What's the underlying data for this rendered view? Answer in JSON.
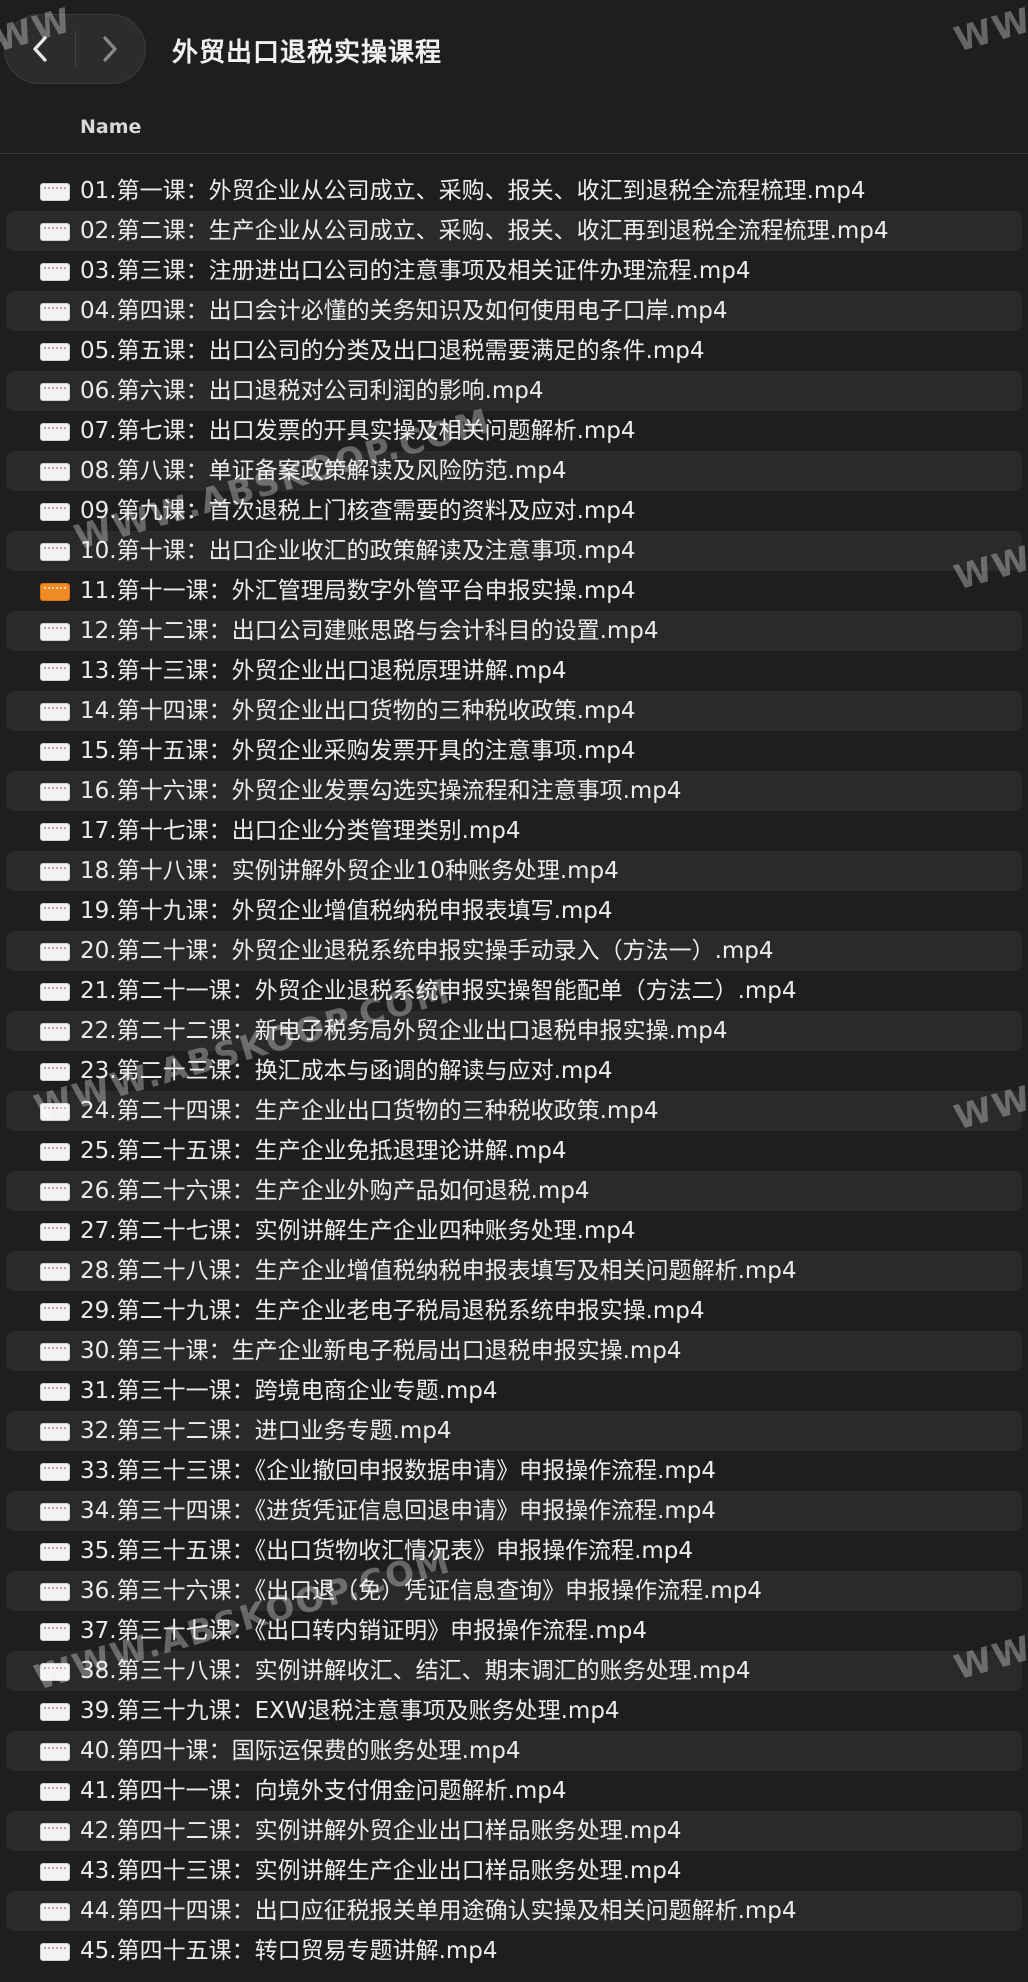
{
  "window": {
    "title": "外贸出口退税实操课程",
    "back_icon": "chevron-left-icon",
    "forward_icon": "chevron-right-icon"
  },
  "columns": {
    "name": "Name"
  },
  "files": [
    {
      "name": "01.第一课：外贸企业从公司成立、采购、报关、收汇到退税全流程梳理.mp4"
    },
    {
      "name": "02.第二课：生产企业从公司成立、采购、报关、收汇再到退税全流程梳理.mp4"
    },
    {
      "name": "03.第三课：注册进出口公司的注意事项及相关证件办理流程.mp4"
    },
    {
      "name": "04.第四课：出口会计必懂的关务知识及如何使用电子口岸.mp4"
    },
    {
      "name": "05.第五课：出口公司的分类及出口退税需要满足的条件.mp4"
    },
    {
      "name": "06.第六课：出口退税对公司利润的影响.mp4"
    },
    {
      "name": "07.第七课：出口发票的开具实操及相关问题解析.mp4"
    },
    {
      "name": "08.第八课：单证备案政策解读及风险防范.mp4"
    },
    {
      "name": "09.第九课：首次退税上门核查需要的资料及应对.mp4"
    },
    {
      "name": "10.第十课：出口企业收汇的政策解读及注意事项.mp4"
    },
    {
      "name": "11.第十一课：外汇管理局数字外管平台申报实操.mp4"
    },
    {
      "name": "12.第十二课：出口公司建账思路与会计科目的设置.mp4"
    },
    {
      "name": "13.第十三课：外贸企业出口退税原理讲解.mp4"
    },
    {
      "name": "14.第十四课：外贸企业出口货物的三种税收政策.mp4"
    },
    {
      "name": "15.第十五课：外贸企业采购发票开具的注意事项.mp4"
    },
    {
      "name": "16.第十六课：外贸企业发票勾选实操流程和注意事项.mp4"
    },
    {
      "name": "17.第十七课：出口企业分类管理类别.mp4"
    },
    {
      "name": "18.第十八课：实例讲解外贸企业10种账务处理.mp4"
    },
    {
      "name": "19.第十九课：外贸企业增值税纳税申报表填写.mp4"
    },
    {
      "name": "20.第二十课：外贸企业退税系统申报实操手动录入（方法一）.mp4"
    },
    {
      "name": "21.第二十一课：外贸企业退税系统申报实操智能配单（方法二）.mp4"
    },
    {
      "name": "22.第二十二课：新电子税务局外贸企业出口退税申报实操.mp4"
    },
    {
      "name": "23.第二十三课：换汇成本与函调的解读与应对.mp4"
    },
    {
      "name": "24.第二十四课：生产企业出口货物的三种税收政策.mp4"
    },
    {
      "name": "25.第二十五课：生产企业免抵退理论讲解.mp4"
    },
    {
      "name": "26.第二十六课：生产企业外购产品如何退税.mp4"
    },
    {
      "name": "27.第二十七课：实例讲解生产企业四种账务处理.mp4"
    },
    {
      "name": "28.第二十八课：生产企业增值税纳税申报表填写及相关问题解析.mp4"
    },
    {
      "name": "29.第二十九课：生产企业老电子税局退税系统申报实操.mp4"
    },
    {
      "name": "30.第三十课：生产企业新电子税局出口退税申报实操.mp4"
    },
    {
      "name": "31.第三十一课：跨境电商企业专题.mp4"
    },
    {
      "name": "32.第三十二课：进口业务专题.mp4"
    },
    {
      "name": "33.第三十三课：《企业撤回申报数据申请》申报操作流程.mp4"
    },
    {
      "name": "34.第三十四课：《进货凭证信息回退申请》申报操作流程.mp4"
    },
    {
      "name": "35.第三十五课：《出口货物收汇情况表》申报操作流程.mp4"
    },
    {
      "name": "36.第三十六课：《出口退（免）凭证信息查询》申报操作流程.mp4"
    },
    {
      "name": "37.第三十七课：《出口转内销证明》申报操作流程.mp4"
    },
    {
      "name": "38.第三十八课：实例讲解收汇、结汇、期末调汇的账务处理.mp4"
    },
    {
      "name": "39.第三十九课：EXW退税注意事项及账务处理.mp4"
    },
    {
      "name": "40.第四十课：国际运保费的账务处理.mp4"
    },
    {
      "name": "41.第四十一课：向境外支付佣金问题解析.mp4"
    },
    {
      "name": "42.第四十二课：实例讲解外贸企业出口样品账务处理.mp4"
    },
    {
      "name": "43.第四十三课：实例讲解生产企业出口样品账务处理.mp4"
    },
    {
      "name": "44.第四十四课：出口应征税报关单用途确认实操及相关问题解析.mp4"
    },
    {
      "name": "45.第四十五课：转口贸易专题讲解.mp4"
    }
  ],
  "highlighted_index": 10,
  "watermark": {
    "main": "WWW.ABSKOOP.COM",
    "edge_left": "WW",
    "edge_right": "WWW"
  },
  "colors": {
    "background": "#1e1e1e",
    "row_alt": "#2a2a2a",
    "highlight_icon": "#f08a24"
  }
}
